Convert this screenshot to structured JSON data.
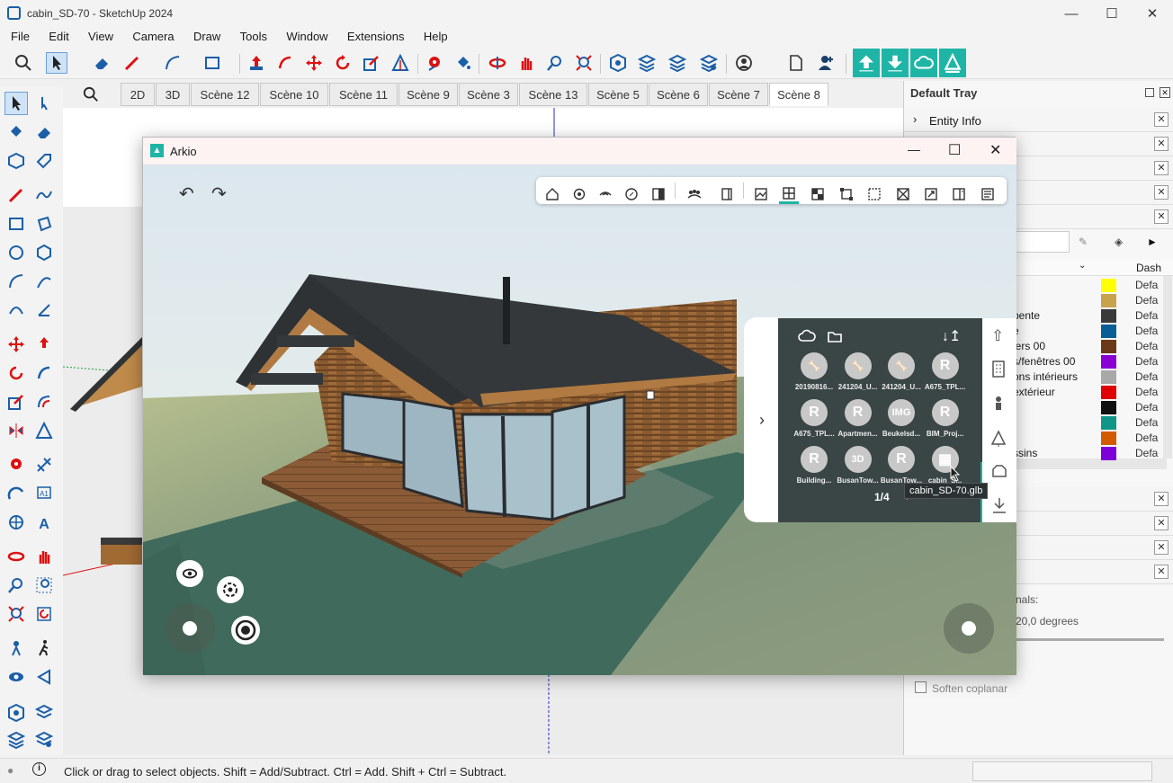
{
  "window": {
    "title": "cabin_SD-70 - SketchUp 2024"
  },
  "menu": [
    "File",
    "Edit",
    "View",
    "Camera",
    "Draw",
    "Tools",
    "Window",
    "Extensions",
    "Help"
  ],
  "scenes": [
    "2D",
    "3D",
    "Scène 12",
    "Scène 10",
    "Scène 11",
    "Scène 9",
    "Scène 3",
    "Scène 13",
    "Scène 5",
    "Scène 6",
    "Scène 7",
    "Scène 8"
  ],
  "active_scene": "Scène 8",
  "status": {
    "text": "Click or drag to select objects. Shift = Add/Subtract. Ctrl = Add. Shift + Ctrl = Subtract."
  },
  "tray": {
    "title": "Default Tray",
    "entity_info": "Entity Info",
    "layers": [
      {
        "name": "",
        "color": "#ffff00",
        "dash": "Defa"
      },
      {
        "name": "",
        "color": "#c9a24c",
        "dash": "Defa"
      },
      {
        "name": "pente",
        "color": "#3a3a3a",
        "dash": "Defa"
      },
      {
        "name": "e",
        "color": "#0a5e96",
        "dash": "Defa"
      },
      {
        "name": "iers 00",
        "color": "#6b3818",
        "dash": "Defa"
      },
      {
        "name": "s/fenêtres 00",
        "color": "#8a00d4",
        "dash": "Defa"
      },
      {
        "name": "ons intérieurs",
        "color": "#a8a8a8",
        "dash": "Defa"
      },
      {
        "name": "extérieur",
        "color": "#e00000",
        "dash": "Defa"
      },
      {
        "name": "",
        "color": "#111111",
        "dash": "Defa"
      },
      {
        "name": "",
        "color": "#0f9688",
        "dash": "Defa"
      },
      {
        "name": "",
        "color": "#d25a00",
        "dash": "Defa"
      },
      {
        "name": "ssins",
        "color": "#7c00d8",
        "dash": "Defa"
      }
    ],
    "dash_header": "Dash",
    "soften": {
      "normals_label": "nals:",
      "angle": "20,0  degrees",
      "coplanar": "Soften coplanar"
    }
  },
  "arkio": {
    "title": "Arkio",
    "page": "1/4",
    "tooltip": "cabin_SD-70.glb",
    "items": [
      {
        "label": "20190816...",
        "glyph": "🦴"
      },
      {
        "label": "241204_U...",
        "glyph": "🦴"
      },
      {
        "label": "241204_U...",
        "glyph": "🦴"
      },
      {
        "label": "A675_TPL...",
        "glyph": "R"
      },
      {
        "label": "A675_TPL...",
        "glyph": "R"
      },
      {
        "label": "Apartmen...",
        "glyph": "R"
      },
      {
        "label": "Beukelsd...",
        "glyph": "IMG"
      },
      {
        "label": "BIM_Proj...",
        "glyph": "R"
      },
      {
        "label": "Building...",
        "glyph": "R"
      },
      {
        "label": "BusanTow...",
        "glyph": "3D"
      },
      {
        "label": "BusanTow...",
        "glyph": "R"
      },
      {
        "label": "cabin_S...",
        "glyph": "▦"
      }
    ]
  },
  "colors": {
    "teal": "#1fb5a6",
    "panel": "#3a4546",
    "ground": "#3f6a5c"
  }
}
